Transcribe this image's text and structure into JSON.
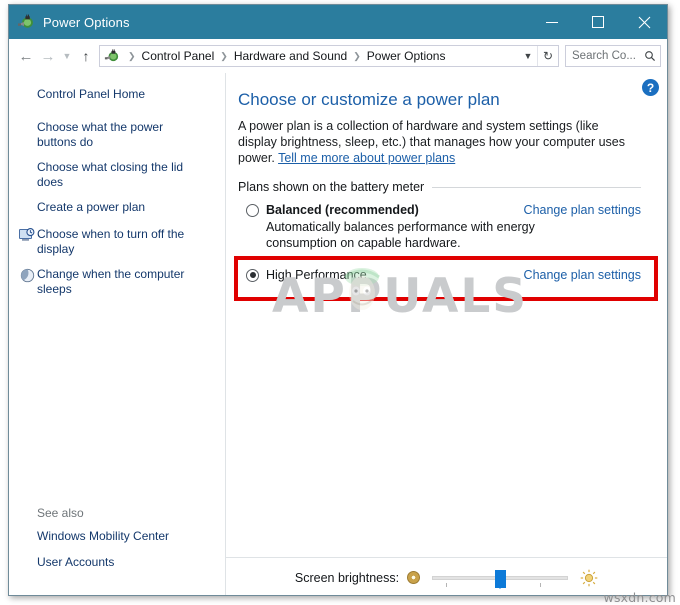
{
  "window": {
    "title": "Power Options",
    "icon": "power-plug-battery-icon",
    "minimize_label": "Minimize",
    "maximize_label": "Maximize",
    "close_label": "Close"
  },
  "nav": {
    "back_label": "Back",
    "forward_label": "Forward",
    "recent_label": "Recent locations",
    "up_label": "Up one level",
    "breadcrumbs": [
      "Control Panel",
      "Hardware and Sound",
      "Power Options"
    ],
    "separator": "❯",
    "dropdown_label": "Previous locations",
    "refresh_label": "Refresh",
    "search_placeholder": "Search Co..."
  },
  "sidebar": {
    "home_label": "Control Panel Home",
    "items": [
      {
        "label": "Choose what the power buttons do",
        "icon": ""
      },
      {
        "label": "Choose what closing the lid does",
        "icon": ""
      },
      {
        "label": "Create a power plan",
        "icon": ""
      },
      {
        "label": "Choose when to turn off the display",
        "icon": "display-clock-icon"
      },
      {
        "label": "Change when the computer sleeps",
        "icon": "moon-sleep-icon"
      }
    ],
    "see_also_title": "See also",
    "see_also": [
      {
        "label": "Windows Mobility Center"
      },
      {
        "label": "User Accounts"
      }
    ]
  },
  "content": {
    "help_label": "?",
    "title": "Choose or customize a power plan",
    "description_part1": "A power plan is a collection of hardware and system settings (like display brightness, sleep, etc.) that manages how your computer uses power. ",
    "description_link": "Tell me more about power plans",
    "group_header": "Plans shown on the battery meter",
    "plans": [
      {
        "name": "Balanced (recommended)",
        "bold": true,
        "selected": false,
        "description": "Automatically balances performance with energy consumption on capable hardware.",
        "link": "Change plan settings"
      },
      {
        "name": "High Performance",
        "bold": false,
        "selected": true,
        "description": "",
        "link": "Change plan settings"
      }
    ],
    "highlight": {
      "color": "#e00000",
      "target_plan": "High Performance"
    },
    "watermark": "APPUALS"
  },
  "bottom": {
    "brightness_label": "Screen brightness:",
    "dim_icon": "dim-brightness-icon",
    "bright_icon": "sun-brightness-icon",
    "slider_value": 50
  },
  "footer_watermark": "wsxdn.com",
  "colors": {
    "titlebar": "#2b7d9e",
    "accent_link": "#1c5fa8",
    "highlight": "#e00000",
    "slider_thumb": "#0d7ad8"
  }
}
